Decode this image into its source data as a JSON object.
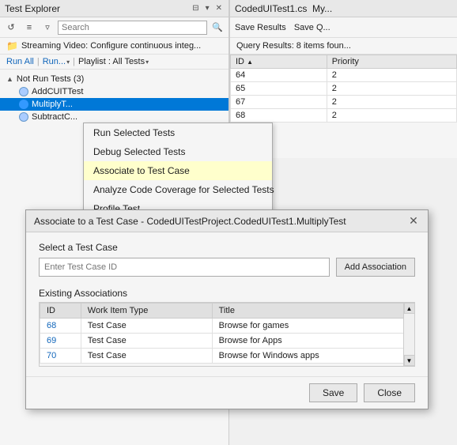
{
  "test_explorer": {
    "title": "Test Explorer",
    "title_icons": [
      "⊟",
      "⊞",
      "─"
    ],
    "toolbar": {
      "search_placeholder": "Search"
    },
    "run_bar": {
      "run_all": "Run All",
      "separator1": "|",
      "run": "Run...",
      "dropdown_arrow": "▾",
      "separator2": "|",
      "playlist_label": "Playlist : All Tests",
      "playlist_arrow": "▾"
    },
    "streaming_bar": {
      "icon": "📁",
      "text": "Streaming Video: Configure continuous integ..."
    },
    "tree": {
      "section": {
        "label": "Not Run Tests (3)",
        "collapse": "▲"
      },
      "items": [
        {
          "name": "AddCUITTest",
          "icon": "light"
        },
        {
          "name": "MultiplyT...",
          "icon": "blue",
          "selected": true
        },
        {
          "name": "SubtractC...",
          "icon": "light"
        }
      ]
    }
  },
  "coded_panel": {
    "title": "CodedUITest1.cs",
    "title_suffix": "My...",
    "toolbar": {
      "save_results": "Save Results",
      "save_q": "Save Q..."
    },
    "query_results": "Query Results: 8 items foun...",
    "table": {
      "headers": [
        "ID",
        "Priority"
      ],
      "rows": [
        {
          "id": "64",
          "priority": "2"
        },
        {
          "id": "65",
          "priority": "2"
        },
        {
          "id": "67",
          "priority": "2"
        },
        {
          "id": "68",
          "priority": "2"
        }
      ]
    }
  },
  "context_menu": {
    "items": [
      "Run Selected Tests",
      "Debug Selected Tests",
      "Associate to Test Case",
      "Analyze Code Coverage for Selected Tests",
      "Profile Test..."
    ],
    "highlighted_index": 2
  },
  "dialog": {
    "title": "Associate to a Test Case - CodedUITestProject.CodedUITest1.MultiplyTest",
    "select_label": "Select a Test Case",
    "input_placeholder": "Enter Test Case ID",
    "add_assoc_label": "Add Association",
    "existing_label": "Existing Associations",
    "table": {
      "headers": [
        "ID",
        "Work Item Type",
        "Title"
      ],
      "rows": [
        {
          "id": "68",
          "type": "Test Case",
          "title": "Browse for games"
        },
        {
          "id": "69",
          "type": "Test Case",
          "title": "Browse for Apps"
        },
        {
          "id": "70",
          "type": "Test Case",
          "title": "Browse for Windows apps"
        }
      ]
    },
    "footer": {
      "save": "Save",
      "close": "Close"
    }
  }
}
